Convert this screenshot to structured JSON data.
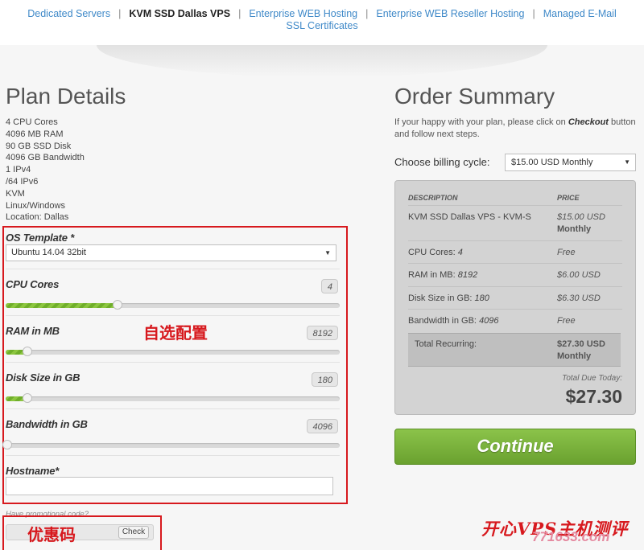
{
  "nav": {
    "items": [
      {
        "label": "Dedicated Servers",
        "active": false
      },
      {
        "label": "KVM SSD Dallas VPS",
        "active": true
      },
      {
        "label": "Enterprise WEB Hosting",
        "active": false
      },
      {
        "label": "Enterprise WEB Reseller Hosting",
        "active": false
      },
      {
        "label": "Managed E-Mail",
        "active": false
      }
    ],
    "row2": {
      "label": "SSL Certificates"
    },
    "separator": "|"
  },
  "plan": {
    "title": "Plan Details",
    "features": [
      "4 CPU Cores",
      "4096 MB RAM",
      "90 GB SSD Disk",
      "4096 GB Bandwidth",
      "1 IPv4",
      "/64 IPv6",
      "KVM",
      "Linux/Windows",
      "Location: Dallas"
    ]
  },
  "config": {
    "os_label": "OS Template *",
    "os_value": "Ubuntu 14.04 32bit",
    "sliders": [
      {
        "label": "CPU Cores",
        "value": "4",
        "fill_fraction": 0.335
      },
      {
        "label": "RAM in MB",
        "value": "8192",
        "fill_fraction": 0.065
      },
      {
        "label": "Disk Size in GB",
        "value": "180",
        "fill_fraction": 0.065
      },
      {
        "label": "Bandwidth in GB",
        "value": "4096",
        "fill_fraction": 0.0
      }
    ],
    "hostname_label": "Hostname*",
    "hostname_value": ""
  },
  "annotations": {
    "custom_config": "自选配置",
    "coupon": "优惠码"
  },
  "promo": {
    "label": "Have promotional code?",
    "value": "",
    "check_label": "Check"
  },
  "order": {
    "title": "Order Summary",
    "intro_before": "If your happy with your plan, please click on ",
    "intro_bold": "Checkout",
    "intro_after": " button and follow next steps.",
    "billing_label": "Choose billing cycle:",
    "billing_value": "$15.00 USD Monthly",
    "headers": {
      "description": "DESCRIPTION",
      "price": "PRICE"
    },
    "rows": [
      {
        "description": "KVM SSD Dallas VPS - KVM-S",
        "price": "$15.00 USD",
        "price2": "Monthly"
      },
      {
        "desc_key": "CPU Cores:",
        "desc_val": "4",
        "price": "Free"
      },
      {
        "desc_key": "RAM in MB:",
        "desc_val": "8192",
        "price": "$6.00 USD"
      },
      {
        "desc_key": "Disk Size in GB:",
        "desc_val": "180",
        "price": "$6.30 USD"
      },
      {
        "desc_key": "Bandwidth in GB:",
        "desc_val": "4096",
        "price": "Free"
      }
    ],
    "recurring": {
      "label": "Total Recurring:",
      "price": "$27.30 USD",
      "price2": "Monthly"
    },
    "due_label": "Total Due Today:",
    "due_value": "$27.30",
    "continue_label": "Continue"
  },
  "watermark": {
    "line1": "开心VPS主机测评",
    "line2": "771633.com"
  },
  "colors": {
    "accent_link": "#3f89c8",
    "annotation_red": "#d7191e",
    "continue_green": "#7ab63d",
    "slider_green": "#8cc63f"
  }
}
